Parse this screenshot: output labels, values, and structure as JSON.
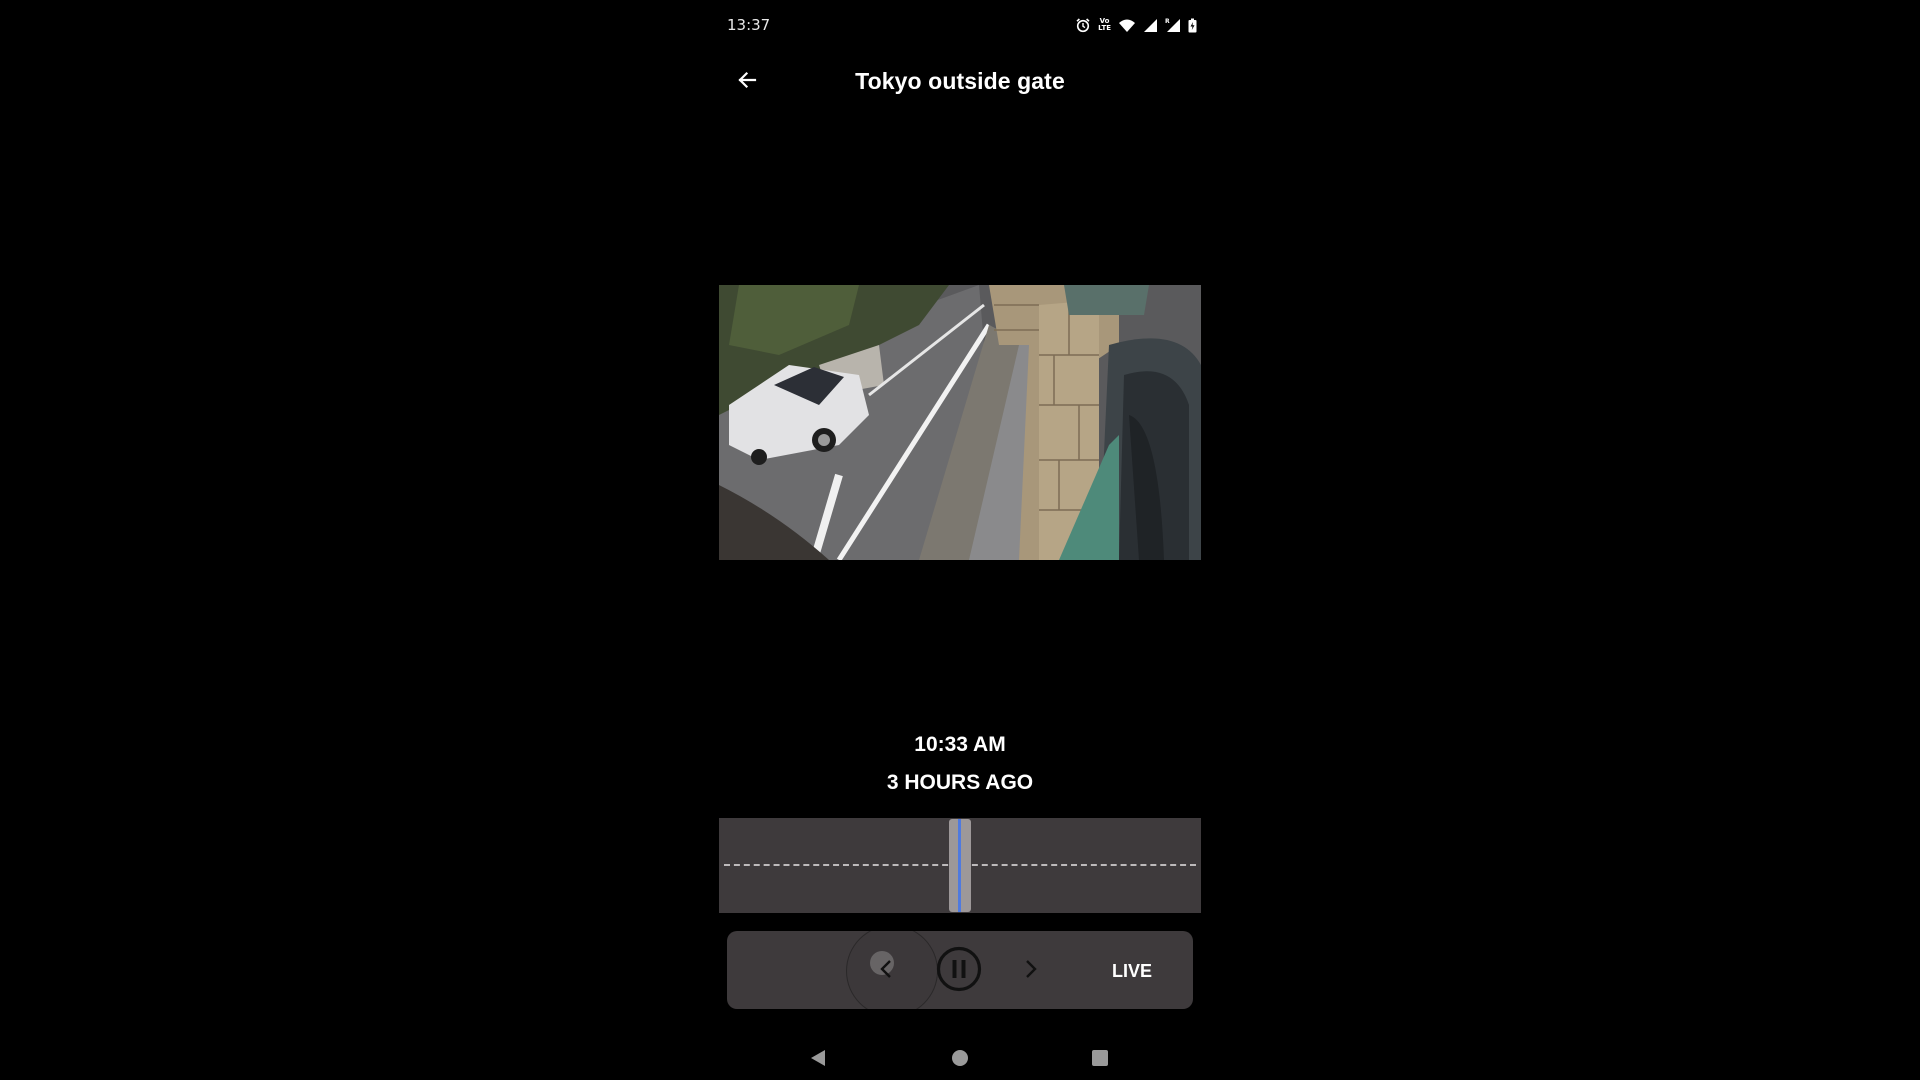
{
  "status_bar": {
    "time": "13:37",
    "icons": [
      "alarm-icon",
      "volte-icon",
      "wifi-icon",
      "signal-icon",
      "roaming-signal-icon",
      "battery-charging-icon"
    ],
    "volte_top": "Vo",
    "volte_bottom": "LTE",
    "roaming_label": "R"
  },
  "app_bar": {
    "back_icon": "arrow-left-icon",
    "title": "Tokyo outside gate"
  },
  "video": {
    "description": "Camera feed: street with white minivan, stone gate pillar, green door"
  },
  "playback": {
    "time": "10:33 AM",
    "relative": "3 HOURS AGO"
  },
  "timeline": {
    "playhead_position": 0.5,
    "colors": {
      "background": "#3e3a3c",
      "playhead": "#9d9899",
      "needle": "#4f7ae0",
      "dash": "#bdbabb"
    }
  },
  "controls": {
    "prev_icon": "chevron-left-icon",
    "pause_icon": "pause-circle-icon",
    "next_icon": "chevron-right-icon",
    "live_label": "LIVE"
  },
  "nav_bar": {
    "back_icon": "nav-back-icon",
    "home_icon": "nav-home-icon",
    "recents_icon": "nav-recents-icon"
  }
}
